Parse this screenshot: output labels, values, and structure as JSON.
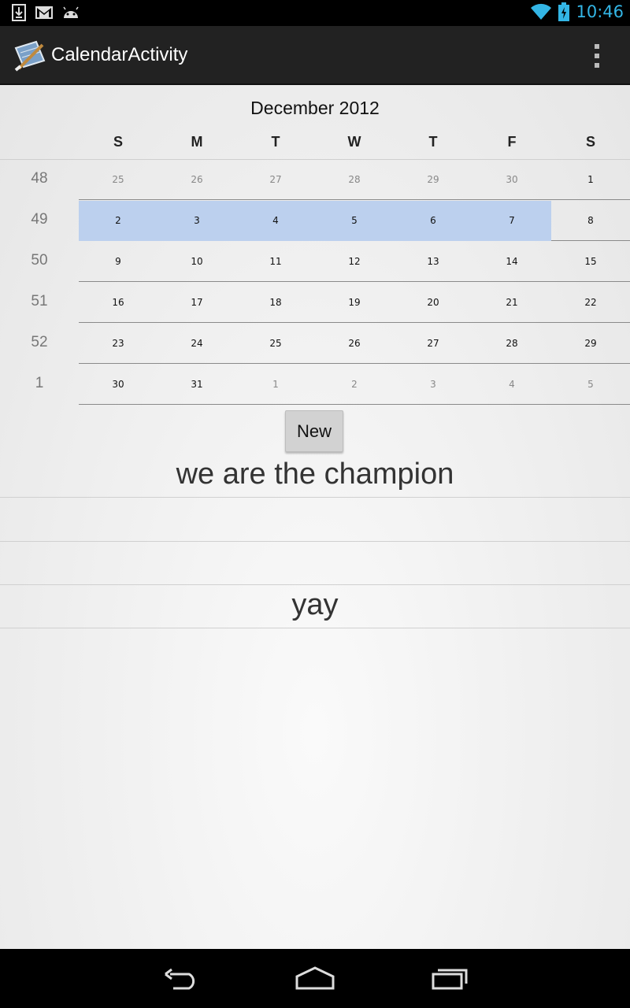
{
  "status_bar": {
    "time": "10:46",
    "left_icons": [
      "download-icon",
      "gmail-icon",
      "android-icon"
    ],
    "right_icons": [
      "wifi-icon",
      "battery-charging-icon"
    ],
    "accent_color": "#33b5e5"
  },
  "action_bar": {
    "title": "CalendarActivity",
    "overflow_icon": "overflow-menu-icon"
  },
  "calendar": {
    "month_title": "December 2012",
    "day_headers": [
      "S",
      "M",
      "T",
      "W",
      "T",
      "F",
      "S"
    ],
    "selected_color": "#bcd0ee",
    "weeks": [
      {
        "week_number": "48",
        "days": [
          {
            "label": "25",
            "other": true
          },
          {
            "label": "26",
            "other": true
          },
          {
            "label": "27",
            "other": true
          },
          {
            "label": "28",
            "other": true
          },
          {
            "label": "29",
            "other": true
          },
          {
            "label": "30",
            "other": true
          },
          {
            "label": "1",
            "other": false
          }
        ]
      },
      {
        "week_number": "49",
        "days": [
          {
            "label": "2",
            "selected": true
          },
          {
            "label": "3",
            "selected": true
          },
          {
            "label": "4",
            "selected": true
          },
          {
            "label": "5",
            "selected": true
          },
          {
            "label": "6",
            "selected": true
          },
          {
            "label": "7",
            "selected": true
          },
          {
            "label": "8"
          }
        ]
      },
      {
        "week_number": "50",
        "days": [
          {
            "label": "9"
          },
          {
            "label": "10"
          },
          {
            "label": "11"
          },
          {
            "label": "12"
          },
          {
            "label": "13"
          },
          {
            "label": "14"
          },
          {
            "label": "15"
          }
        ]
      },
      {
        "week_number": "51",
        "days": [
          {
            "label": "16"
          },
          {
            "label": "17"
          },
          {
            "label": "18"
          },
          {
            "label": "19"
          },
          {
            "label": "20"
          },
          {
            "label": "21"
          },
          {
            "label": "22"
          }
        ]
      },
      {
        "week_number": "52",
        "days": [
          {
            "label": "23"
          },
          {
            "label": "24"
          },
          {
            "label": "25"
          },
          {
            "label": "26"
          },
          {
            "label": "27"
          },
          {
            "label": "28"
          },
          {
            "label": "29"
          }
        ]
      },
      {
        "week_number": "1",
        "days": [
          {
            "label": "30"
          },
          {
            "label": "31"
          },
          {
            "label": "1",
            "other": true
          },
          {
            "label": "2",
            "other": true
          },
          {
            "label": "3",
            "other": true
          },
          {
            "label": "4",
            "other": true
          },
          {
            "label": "5",
            "other": true
          }
        ]
      }
    ]
  },
  "new_button": {
    "label": "New"
  },
  "event_list": [
    {
      "text": "we are the champion"
    },
    {
      "text": ""
    },
    {
      "text": ""
    },
    {
      "text": "yay"
    }
  ],
  "nav_bar": {
    "icons": [
      "back-icon",
      "home-icon",
      "recent-apps-icon"
    ]
  }
}
